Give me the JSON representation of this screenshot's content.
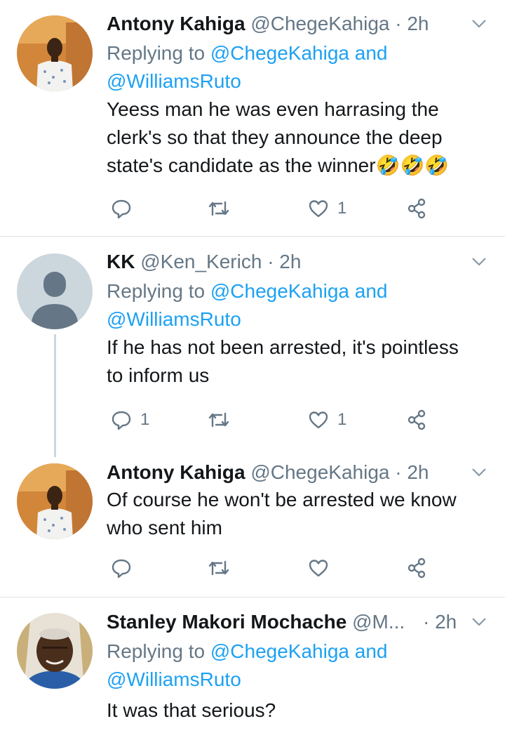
{
  "tweets": [
    {
      "name": "Antony Kahiga",
      "handle": "@ChegeKahiga",
      "time": "· 2h",
      "reply_prefix": "Replying to",
      "reply_to_1": "@ChegeKahiga and",
      "reply_to_2": "@WilliamsRuto",
      "lines": [
        "Yeess man he was even harrasing the",
        "clerk's so that they announce the deep",
        "state's candidate as the winner🤣🤣🤣"
      ],
      "reply_count": "",
      "retweet_count": "",
      "like_count": "1"
    },
    {
      "name": "KK",
      "handle": "@Ken_Kerich",
      "time": "· 2h",
      "reply_prefix": "Replying to",
      "reply_to_1": "@ChegeKahiga and",
      "reply_to_2": "@WilliamsRuto",
      "lines": [
        "If he has not been arrested, it's pointless",
        "to inform us"
      ],
      "reply_count": "1",
      "retweet_count": "",
      "like_count": "1"
    },
    {
      "name": "Antony Kahiga",
      "handle": "@ChegeKahiga",
      "time": "· 2h",
      "lines": [
        "Of course he won't be arrested we know",
        "who sent him"
      ],
      "reply_count": "",
      "retweet_count": "",
      "like_count": ""
    },
    {
      "name": "Stanley Makori Mochache",
      "handle": "@M...",
      "time": "· 2h",
      "reply_prefix": "Replying to",
      "reply_to_1": "@ChegeKahiga and",
      "reply_to_2": "@WilliamsRuto",
      "lines": [
        "It was that serious?"
      ]
    }
  ],
  "colors": {
    "link": "#1da1f2",
    "secondary": "#657786",
    "divider": "#dfe3e8",
    "thread_line": "#ccd6dd"
  },
  "icons": [
    "reply-icon",
    "retweet-icon",
    "like-icon",
    "share-icon",
    "chevron-down-icon"
  ]
}
